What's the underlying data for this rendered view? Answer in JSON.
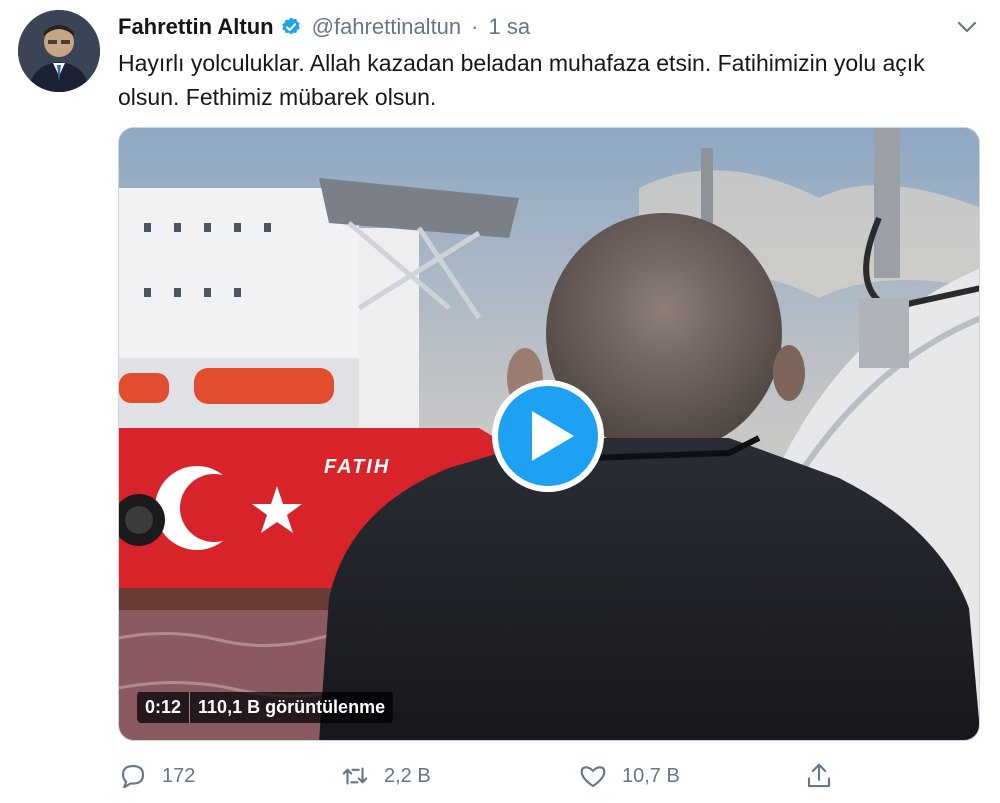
{
  "author": {
    "name": "Fahrettin Altun",
    "handle": "@fahrettinaltun",
    "separator": "·",
    "time": "1 sa"
  },
  "tweet": {
    "text": "Hayırlı yolculuklar. Allah kazadan beladan muhafaza etsin. Fatihimizin yolu açık olsun. Fethimiz mübarek olsun."
  },
  "video": {
    "duration": "0:12",
    "views": "110,1 B görüntülenme",
    "ship_name": "FATIH"
  },
  "actions": {
    "reply_count": "172",
    "retweet_count": "2,2 B",
    "like_count": "10,7 B"
  },
  "icons": {
    "verified": "verified-badge-icon",
    "caret": "chevron-down-icon",
    "reply": "comment-icon",
    "retweet": "retweet-icon",
    "like": "heart-icon",
    "share": "share-icon",
    "play": "play-icon"
  },
  "colors": {
    "accent": "#1da1f2",
    "muted": "#657786",
    "text": "#14171a",
    "ship_red": "#d8232a"
  }
}
